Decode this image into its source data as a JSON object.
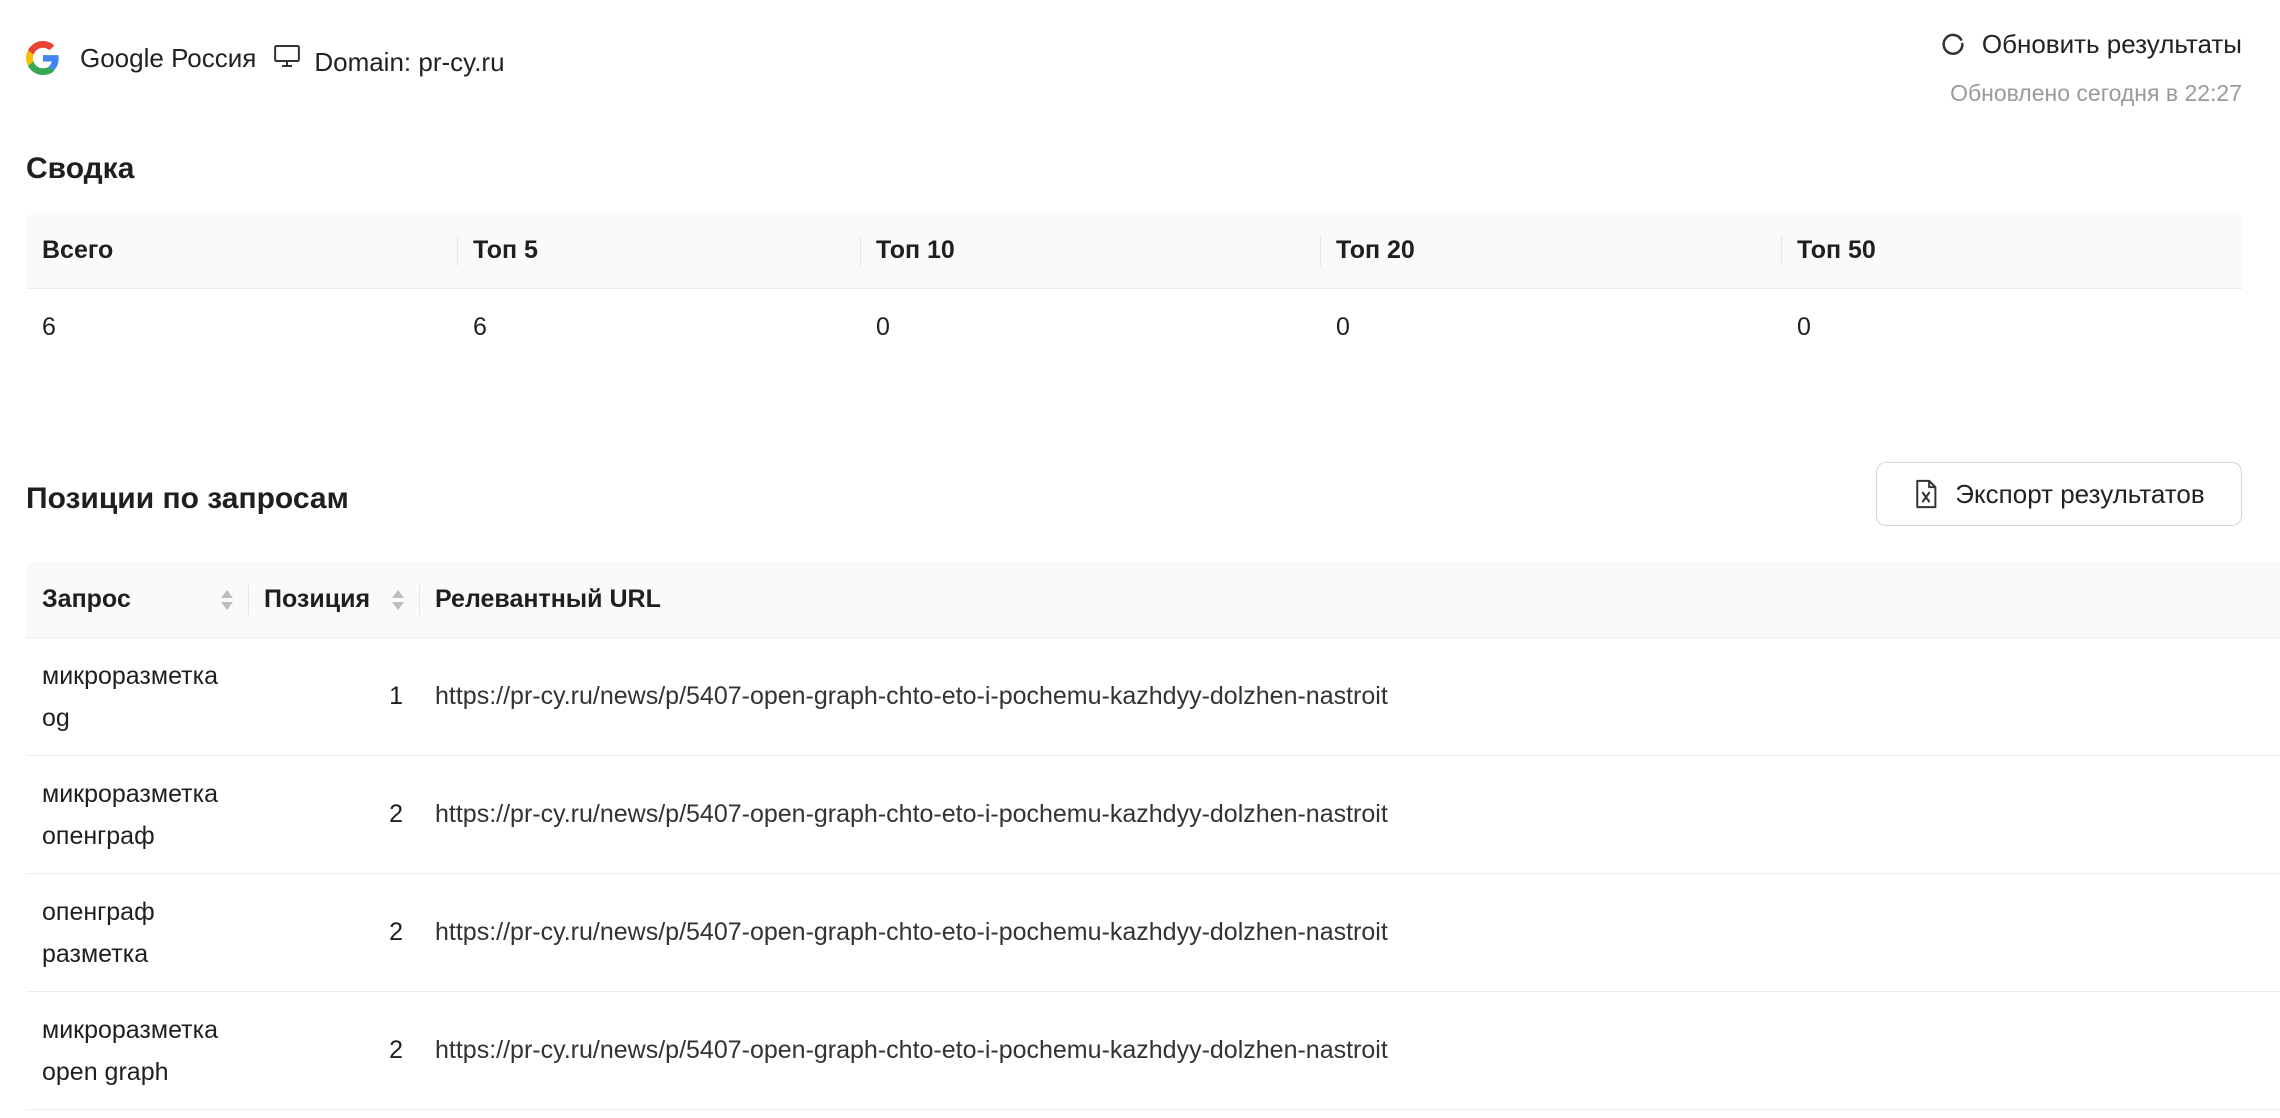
{
  "header": {
    "search_engine": "Google Россия",
    "domain_label": "Domain: pr-cy.ru",
    "refresh_label": "Обновить результаты",
    "updated_label": "Обновлено сегодня в 22:27"
  },
  "icons": {
    "google": "google-icon",
    "device": "monitor-icon",
    "refresh": "refresh-icon",
    "export": "excel-file-icon",
    "sort": "sort-icon"
  },
  "summary": {
    "title": "Сводка",
    "headers": [
      "Всего",
      "Топ 5",
      "Топ 10",
      "Топ 20",
      "Топ 50"
    ],
    "values": [
      "6",
      "6",
      "0",
      "0",
      "0"
    ]
  },
  "positions": {
    "title": "Позиции по запросам",
    "export_label": "Экспорт результатов",
    "headers": {
      "query": "Запрос",
      "position": "Позиция",
      "url": "Релевантный URL"
    },
    "rows": [
      {
        "query": "микроразметка og",
        "position": "1",
        "url": "https://pr-cy.ru/news/p/5407-open-graph-chto-eto-i-pochemu-kazhdyy-dolzhen-nastroit"
      },
      {
        "query": "микроразметка опенграф",
        "position": "2",
        "url": "https://pr-cy.ru/news/p/5407-open-graph-chto-eto-i-pochemu-kazhdyy-dolzhen-nastroit"
      },
      {
        "query": "опенграф разметка",
        "position": "2",
        "url": "https://pr-cy.ru/news/p/5407-open-graph-chto-eto-i-pochemu-kazhdyy-dolzhen-nastroit"
      },
      {
        "query": "микроразметка open graph",
        "position": "2",
        "url": "https://pr-cy.ru/news/p/5407-open-graph-chto-eto-i-pochemu-kazhdyy-dolzhen-nastroit"
      }
    ]
  },
  "colors": {
    "header_bg": "#fafafa",
    "border": "#ececec",
    "muted_text": "#9a9a9a",
    "google_blue": "#4285F4",
    "google_red": "#EA4335",
    "google_yellow": "#FBBC05",
    "google_green": "#34A853"
  }
}
